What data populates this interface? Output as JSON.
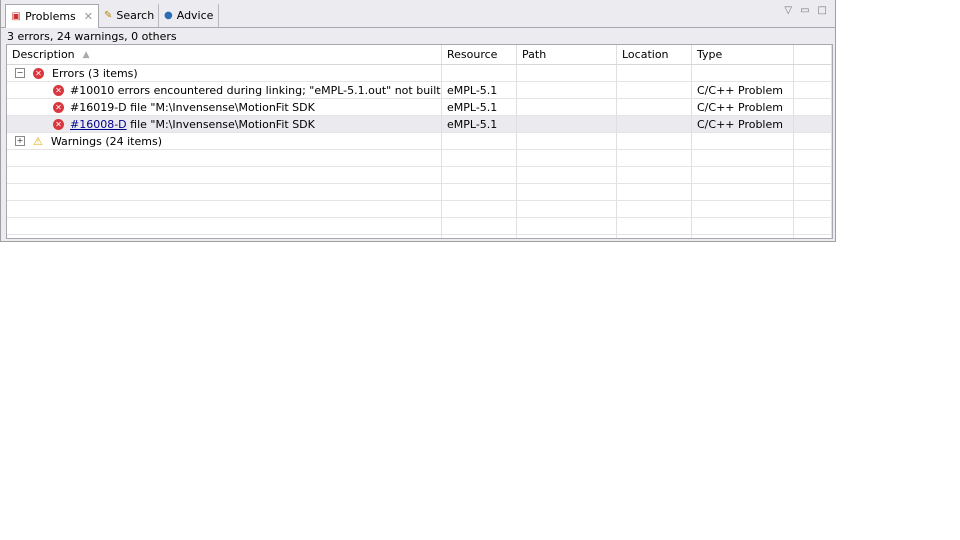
{
  "tabs": [
    {
      "label": "Problems",
      "icon": "problems-icon",
      "close": "✕"
    },
    {
      "label": "Search",
      "icon": "search-flashlight-icon"
    },
    {
      "label": "Advice",
      "icon": "globe-icon"
    }
  ],
  "status": "3 errors, 24 warnings, 0 others",
  "columns": [
    "Description",
    "Resource",
    "Path",
    "Location",
    "Type"
  ],
  "groups": {
    "errors": "Errors (3 items)",
    "warnings": "Warnings (24 items)"
  },
  "rows": [
    {
      "desc": "#10010 errors encountered during linking; \"eMPL-5.1.out\" not built",
      "resource": "eMPL-5.1",
      "type": "C/C++ Problem"
    },
    {
      "desc": "#16019-D file \"M:\\Invensense\\MotionFit SDK",
      "resource": "eMPL-5.1",
      "type": "C/C++ Problem"
    },
    {
      "link": "#16008-D",
      "desc": " file \"M:\\Invensense\\MotionFit SDK",
      "resource": "eMPL-5.1",
      "type": "C/C++ Problem"
    }
  ],
  "colors": {
    "error": "#d9363e",
    "warning": "#e0a800",
    "link": "#00008b"
  }
}
